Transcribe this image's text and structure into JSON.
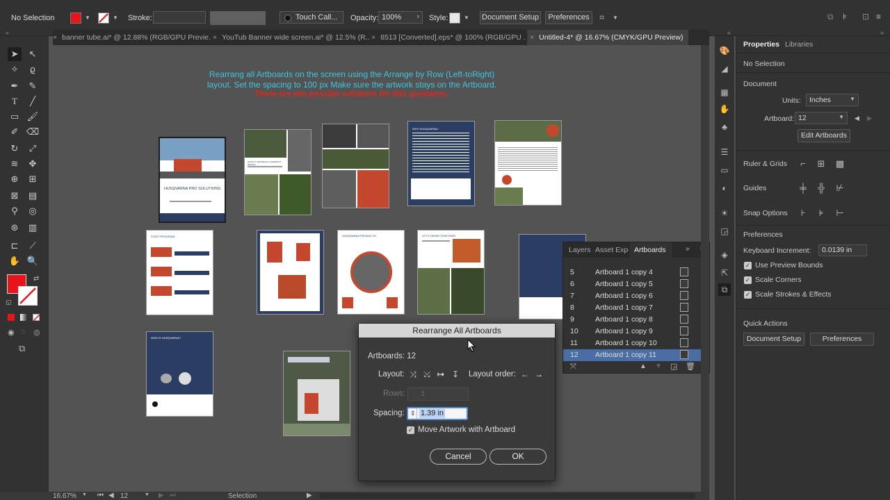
{
  "control_bar": {
    "selection": "No Selection",
    "stroke_label": "Stroke:",
    "brush_label": "Touch Call...",
    "opacity_label": "Opacity:",
    "opacity_value": "100%",
    "style_label": "Style:",
    "document_setup": "Document Setup",
    "preferences": "Preferences",
    "fill_color": "#e8141c"
  },
  "tabs": [
    {
      "label": "banner tube.ai* @ 12.88% (RGB/GPU Previe...",
      "active": false
    },
    {
      "label": "YouTub Banner wide screen.ai* @ 12.5% (R...",
      "active": false
    },
    {
      "label": "8513 [Converted].eps* @ 100% (RGB/GPU ...",
      "active": false
    },
    {
      "label": "Untitled-4* @ 16.67% (CMYK/GPU Preview)",
      "active": true
    }
  ],
  "instructions": {
    "line1": "Rearrang all Artboards on the screen using the Arrange by Row (Left-toRight)",
    "line2": "layout. Set the spacing to 100 px Make sure the artwork stays on the Artboard.",
    "line3": "There are two possibe solutions for this questions.",
    "color_main": "#3fc5dd",
    "color_red": "#e0261f"
  },
  "artboard_texts": {
    "husqvarna_pro": "HUSQVARNA PRO SOLUTIONS.",
    "why": "WHY HUSQVARNA?",
    "fleet": "FLEET PROGRAM.",
    "products": "HUSQVARNA PRODUCTS.",
    "grow": "LET'S GROW TOGETHER.",
    "who": "WHO IS HUSQVARNA?",
    "quality": "QUALITY MATERIALS. SUPERIOR DESIGN."
  },
  "status_bar": {
    "zoom": "16.67%",
    "artboard_num": "12",
    "mode": "Selection"
  },
  "properties": {
    "tab_properties": "Properties",
    "tab_libraries": "Libraries",
    "no_selection": "No Selection",
    "document_heading": "Document",
    "units_label": "Units:",
    "units_value": "Inches",
    "artboard_label": "Artboard:",
    "artboard_value": "12",
    "edit_artboards": "Edit Artboards",
    "ruler_grids": "Ruler & Grids",
    "guides": "Guides",
    "snap_options": "Snap Options",
    "preferences_heading": "Preferences",
    "keyboard_increment_label": "Keyboard Increment:",
    "keyboard_increment_value": "0.0139 in",
    "use_preview_bounds": "Use Preview Bounds",
    "scale_corners": "Scale Corners",
    "scale_strokes": "Scale Strokes & Effects",
    "quick_actions": "Quick Actions",
    "qa_document_setup": "Document Setup",
    "qa_preferences": "Preferences"
  },
  "artboards_panel": {
    "tab_layers": "Layers",
    "tab_asset": "Asset Expo",
    "tab_artboards": "Artboards",
    "rows": [
      {
        "num": "5",
        "label": "Artboard 1 copy 4",
        "selected": false
      },
      {
        "num": "6",
        "label": "Artboard 1 copy 5",
        "selected": false
      },
      {
        "num": "7",
        "label": "Artboard 1 copy 6",
        "selected": false
      },
      {
        "num": "8",
        "label": "Artboard 1 copy 7",
        "selected": false
      },
      {
        "num": "9",
        "label": "Artboard 1 copy 8",
        "selected": false
      },
      {
        "num": "10",
        "label": "Artboard 1 copy 9",
        "selected": false
      },
      {
        "num": "11",
        "label": "Artboard 1 copy 10",
        "selected": false
      },
      {
        "num": "12",
        "label": "Artboard 1 copy 11",
        "selected": true
      }
    ]
  },
  "dialog": {
    "title": "Rearrange All Artboards",
    "artboards_label": "Artboards: 12",
    "layout_label": "Layout:",
    "layout_order_label": "Layout order:",
    "rows_label": "Rows:",
    "rows_value": "1",
    "spacing_label": "Spacing:",
    "spacing_value": "1.39 in",
    "move_artwork": "Move Artwork with Artboard",
    "cancel": "Cancel",
    "ok": "OK"
  }
}
